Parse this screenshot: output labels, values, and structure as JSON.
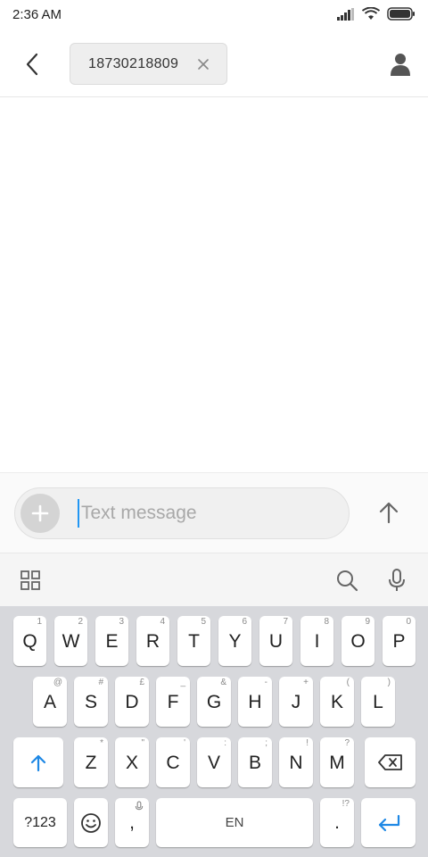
{
  "status_bar": {
    "time": "2:36 AM",
    "icons": [
      "signal-icon",
      "wifi-icon",
      "battery-icon"
    ]
  },
  "header": {
    "back_icon": "back-arrow-icon",
    "recipient": "18730218809",
    "chip_close_icon": "close-icon",
    "contact_icon": "person-icon"
  },
  "compose": {
    "attach_icon": "plus-icon",
    "placeholder": "Text message",
    "value": "",
    "send_icon": "up-arrow-icon"
  },
  "keyboard_toolbar": {
    "icons": [
      "grid-icon",
      "search-icon",
      "microphone-icon"
    ]
  },
  "keyboard": {
    "row1": [
      {
        "label": "Q",
        "hint": "1"
      },
      {
        "label": "W",
        "hint": "2"
      },
      {
        "label": "E",
        "hint": "3"
      },
      {
        "label": "R",
        "hint": "4"
      },
      {
        "label": "T",
        "hint": "5"
      },
      {
        "label": "Y",
        "hint": "6"
      },
      {
        "label": "U",
        "hint": "7"
      },
      {
        "label": "I",
        "hint": "8"
      },
      {
        "label": "O",
        "hint": "9"
      },
      {
        "label": "P",
        "hint": "0"
      }
    ],
    "row2": [
      {
        "label": "A",
        "hint": "@"
      },
      {
        "label": "S",
        "hint": "#"
      },
      {
        "label": "D",
        "hint": "£"
      },
      {
        "label": "F",
        "hint": "_"
      },
      {
        "label": "G",
        "hint": "&"
      },
      {
        "label": "H",
        "hint": "-"
      },
      {
        "label": "J",
        "hint": "+"
      },
      {
        "label": "K",
        "hint": "("
      },
      {
        "label": "L",
        "hint": ")"
      }
    ],
    "row3": [
      {
        "label": "Z",
        "hint": "*"
      },
      {
        "label": "X",
        "hint": "\""
      },
      {
        "label": "C",
        "hint": "'"
      },
      {
        "label": "V",
        "hint": ":"
      },
      {
        "label": "B",
        "hint": ";"
      },
      {
        "label": "N",
        "hint": "!"
      },
      {
        "label": "M",
        "hint": "?"
      }
    ],
    "shift_icon": "shift-icon",
    "backspace_icon": "backspace-icon",
    "symbols_label": "?123",
    "emoji_icon": "emoji-icon",
    "comma": {
      "label": ",",
      "hint_icon": "microphone-icon"
    },
    "space_label": "EN",
    "period": {
      "label": ".",
      "hint": "!?"
    },
    "enter_icon": "enter-icon",
    "accent_color": "#1e88e5"
  }
}
